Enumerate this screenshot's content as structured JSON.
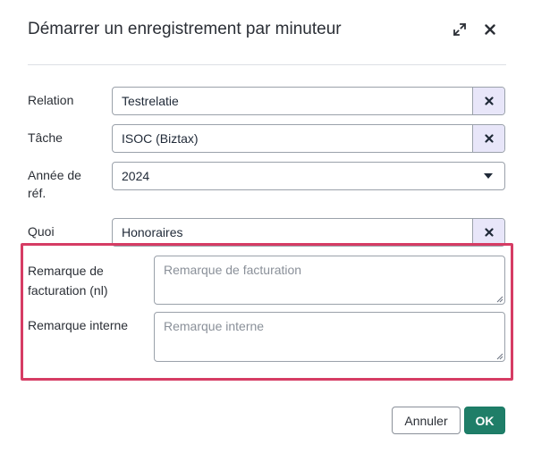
{
  "dialog": {
    "title": "Démarrer un enregistrement par minuteur",
    "expand_icon": "expand-icon",
    "close_icon": "close-icon"
  },
  "form": {
    "relation": {
      "label": "Relation",
      "value": "Testrelatie"
    },
    "task": {
      "label": "Tâche",
      "value": "ISOC (Biztax)"
    },
    "ref_year": {
      "label_line1": "Année de",
      "label_line2": "réf.",
      "value": "2024"
    },
    "what": {
      "label": "Quoi",
      "value": "Honoraires"
    },
    "billing_remark": {
      "label_line1": "Remarque de",
      "label_line2": "facturation (nl)",
      "placeholder": "Remarque de facturation"
    },
    "internal_remark": {
      "label": "Remarque interne",
      "placeholder": "Remarque interne"
    }
  },
  "footer": {
    "cancel_label": "Annuler",
    "ok_label": "OK"
  },
  "colors": {
    "accent_ok": "#1f7e68",
    "clear_button_bg": "#e8e6f9",
    "highlight_border": "#d63c64"
  }
}
